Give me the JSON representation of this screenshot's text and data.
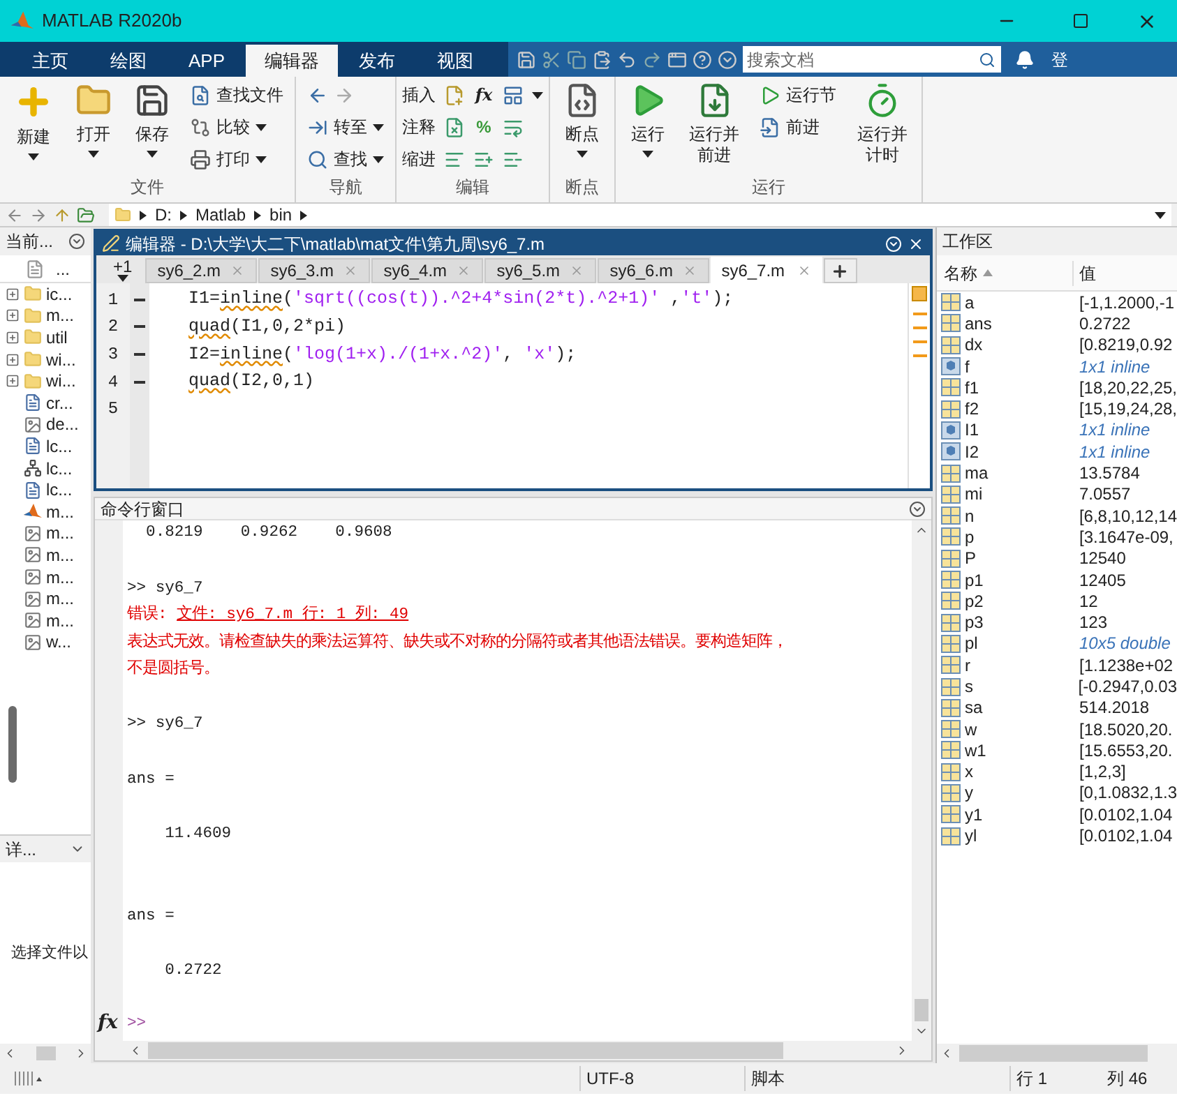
{
  "window": {
    "title": "MATLAB R2020b"
  },
  "ribbon_tabs": [
    {
      "label": "主页",
      "selected": false
    },
    {
      "label": "绘图",
      "selected": false
    },
    {
      "label": "APP",
      "selected": false
    },
    {
      "label": "编辑器",
      "selected": true
    },
    {
      "label": "发布",
      "selected": false
    },
    {
      "label": "视图",
      "selected": false
    }
  ],
  "search": {
    "placeholder": "搜索文档"
  },
  "sign_in": "登",
  "toolstrip": [
    {
      "label": "文件",
      "columns": [
        {
          "kind": "large",
          "items": [
            {
              "label": "新建",
              "dropdown": true
            }
          ]
        },
        {
          "kind": "large",
          "items": [
            {
              "label": "打开",
              "dropdown": true
            }
          ]
        },
        {
          "kind": "large",
          "items": [
            {
              "label": "保存",
              "dropdown": true
            }
          ]
        },
        {
          "kind": "stack",
          "items": [
            {
              "label": "查找文件",
              "dropdown": false
            },
            {
              "label": "比较",
              "dropdown": true
            },
            {
              "label": "打印",
              "dropdown": true
            }
          ]
        }
      ]
    },
    {
      "label": "导航",
      "columns": [
        {
          "kind": "stack",
          "items": [
            {
              "kind": "arrows"
            },
            {
              "label": "转至",
              "dropdown": true
            },
            {
              "label": "查找",
              "dropdown": true
            }
          ]
        }
      ]
    },
    {
      "label": "编辑",
      "columns": [
        {
          "kind": "rows",
          "items": [
            {
              "label": "插入",
              "glyph": "fx",
              "dropdown": true
            },
            {
              "label": "注释",
              "glyph": "%",
              "dropdown": false
            },
            {
              "label": "缩进",
              "dropdown": false
            }
          ]
        }
      ]
    },
    {
      "label": "断点",
      "columns": [
        {
          "kind": "large",
          "items": [
            {
              "label": "断点",
              "dropdown": true
            }
          ]
        }
      ]
    },
    {
      "label": "运行",
      "columns": [
        {
          "kind": "large",
          "items": [
            {
              "label": "运行",
              "dropdown": true
            }
          ]
        },
        {
          "kind": "large",
          "items": [
            {
              "label": "运行并前进",
              "dropdown": false
            }
          ]
        },
        {
          "kind": "stack",
          "items": [
            {
              "label": "运行节",
              "dropdown": false
            },
            {
              "label": "前进",
              "dropdown": false
            }
          ]
        },
        {
          "kind": "large",
          "items": [
            {
              "label": "运行并计时",
              "dropdown": false
            }
          ]
        }
      ]
    }
  ],
  "address_bar": {
    "path": [
      "D:",
      "Matlab",
      "bin"
    ]
  },
  "current_folder": {
    "title": "当前...",
    "column": "...",
    "items": [
      {
        "kind": "folder",
        "name": "ic..."
      },
      {
        "kind": "folder",
        "name": "m..."
      },
      {
        "kind": "folder",
        "name": "util"
      },
      {
        "kind": "folder",
        "name": "wi..."
      },
      {
        "kind": "folder",
        "name": "wi..."
      },
      {
        "kind": "file",
        "name": "cr..."
      },
      {
        "kind": "image",
        "name": "de..."
      },
      {
        "kind": "file",
        "name": "lc..."
      },
      {
        "kind": "network",
        "name": "lc..."
      },
      {
        "kind": "file",
        "name": "lc..."
      },
      {
        "kind": "matlab",
        "name": "m..."
      },
      {
        "kind": "image",
        "name": "m..."
      },
      {
        "kind": "image",
        "name": "m..."
      },
      {
        "kind": "image",
        "name": "m..."
      },
      {
        "kind": "image",
        "name": "m..."
      },
      {
        "kind": "image",
        "name": "m..."
      },
      {
        "kind": "image",
        "name": "w..."
      }
    ],
    "details": "详...",
    "details_text": "选择文件以"
  },
  "editor": {
    "title": "编辑器 - D:\\大学\\大二下\\matlab\\mat文件\\第九周\\sy6_7.m",
    "overflow_tab": "+1",
    "tabs": [
      {
        "label": "sy6_2.m",
        "selected": false
      },
      {
        "label": "sy6_3.m",
        "selected": false
      },
      {
        "label": "sy6_4.m",
        "selected": false
      },
      {
        "label": "sy6_5.m",
        "selected": false
      },
      {
        "label": "sy6_6.m",
        "selected": false
      },
      {
        "label": "sy6_7.m",
        "selected": true
      }
    ],
    "lines": [
      {
        "number": "1",
        "executable": true,
        "segments": [
          {
            "kind": "code",
            "text": "I1="
          },
          {
            "kind": "warn",
            "text": "inline"
          },
          {
            "kind": "code",
            "text": "("
          },
          {
            "kind": "string",
            "text": "'sqrt((cos(t)).^2+4*sin(2*t).^2+1)'"
          },
          {
            "kind": "code",
            "text": " ,"
          },
          {
            "kind": "string",
            "text": "'t'"
          },
          {
            "kind": "code",
            "text": ");"
          }
        ]
      },
      {
        "number": "2",
        "executable": true,
        "segments": [
          {
            "kind": "warn",
            "text": "quad"
          },
          {
            "kind": "code",
            "text": "(I1,0,2*pi)"
          }
        ]
      },
      {
        "number": "3",
        "executable": true,
        "segments": [
          {
            "kind": "code",
            "text": "I2="
          },
          {
            "kind": "warn",
            "text": "inline"
          },
          {
            "kind": "code",
            "text": "("
          },
          {
            "kind": "string",
            "text": "'log(1+x)./(1+x.^2)'"
          },
          {
            "kind": "code",
            "text": ", "
          },
          {
            "kind": "string",
            "text": "'x'"
          },
          {
            "kind": "code",
            "text": ");"
          }
        ]
      },
      {
        "number": "4",
        "executable": true,
        "segments": [
          {
            "kind": "warn",
            "text": "quad"
          },
          {
            "kind": "code",
            "text": "(I2,0,1)"
          }
        ]
      },
      {
        "number": "5",
        "executable": false
      }
    ]
  },
  "command_window": {
    "title": "命令行窗口",
    "fx": "fx",
    "prompt": ">>",
    "lines": [
      {
        "kind": "output",
        "text": "  0.8219    0.9262    0.9608"
      },
      {
        "kind": "blank"
      },
      {
        "kind": "input",
        "text": ">> sy6_7"
      },
      {
        "kind": "error",
        "text": "错误: ",
        "link": "文件: sy6_7.m 行: 1 列: 49"
      },
      {
        "kind": "error",
        "text": "表达式无效。请检查缺失的乘法运算符、缺失或不对称的分隔符或者其他语法错误。要构造矩阵，"
      },
      {
        "kind": "error",
        "text": "不是圆括号。"
      },
      {
        "kind": "blank"
      },
      {
        "kind": "input",
        "text": ">> sy6_7"
      },
      {
        "kind": "blank"
      },
      {
        "kind": "output",
        "text": "ans ="
      },
      {
        "kind": "blank"
      },
      {
        "kind": "output",
        "text": "    11.4609"
      },
      {
        "kind": "blank"
      },
      {
        "kind": "blank"
      },
      {
        "kind": "output",
        "text": "ans ="
      },
      {
        "kind": "blank"
      },
      {
        "kind": "output",
        "text": "    0.2722"
      }
    ]
  },
  "workspace": {
    "title": "工作区",
    "columns": [
      "名称",
      "值"
    ],
    "rows": [
      {
        "kind": "matrix",
        "name": "a",
        "value": "[-1,1.2000,-1",
        "italic": false
      },
      {
        "kind": "matrix",
        "name": "ans",
        "value": "0.2722",
        "italic": false
      },
      {
        "kind": "matrix",
        "name": "dx",
        "value": "[0.8219,0.92",
        "italic": false
      },
      {
        "kind": "object",
        "name": "f",
        "value": "1x1 inline",
        "italic": true
      },
      {
        "kind": "matrix",
        "name": "f1",
        "value": "[18,20,22,25,",
        "italic": false
      },
      {
        "kind": "matrix",
        "name": "f2",
        "value": "[15,19,24,28,",
        "italic": false
      },
      {
        "kind": "object",
        "name": "I1",
        "value": "1x1 inline",
        "italic": true
      },
      {
        "kind": "object",
        "name": "I2",
        "value": "1x1 inline",
        "italic": true
      },
      {
        "kind": "matrix",
        "name": "ma",
        "value": "13.5784",
        "italic": false
      },
      {
        "kind": "matrix",
        "name": "mi",
        "value": "7.0557",
        "italic": false
      },
      {
        "kind": "matrix",
        "name": "n",
        "value": "[6,8,10,12,14",
        "italic": false
      },
      {
        "kind": "matrix",
        "name": "p",
        "value": "[3.1647e-09,",
        "italic": false
      },
      {
        "kind": "matrix",
        "name": "P",
        "value": "12540",
        "italic": false
      },
      {
        "kind": "matrix",
        "name": "p1",
        "value": "12405",
        "italic": false
      },
      {
        "kind": "matrix",
        "name": "p2",
        "value": "12",
        "italic": false
      },
      {
        "kind": "matrix",
        "name": "p3",
        "value": "123",
        "italic": false
      },
      {
        "kind": "matrix",
        "name": "pl",
        "value": "10x5 double",
        "italic": true
      },
      {
        "kind": "matrix",
        "name": "r",
        "value": "[1.1238e+02",
        "italic": false
      },
      {
        "kind": "matrix",
        "name": "s",
        "value": "[-0.2947,0.03",
        "italic": false
      },
      {
        "kind": "matrix",
        "name": "sa",
        "value": "514.2018",
        "italic": false
      },
      {
        "kind": "matrix",
        "name": "w",
        "value": "[18.5020,20.",
        "italic": false
      },
      {
        "kind": "matrix",
        "name": "w1",
        "value": "[15.6553,20.",
        "italic": false
      },
      {
        "kind": "matrix",
        "name": "x",
        "value": "[1,2,3]",
        "italic": false
      },
      {
        "kind": "matrix",
        "name": "y",
        "value": "[0,1.0832,1.3",
        "italic": false
      },
      {
        "kind": "matrix",
        "name": "y1",
        "value": "[0.0102,1.04",
        "italic": false
      },
      {
        "kind": "matrix",
        "name": "yl",
        "value": "[0.0102,1.04",
        "italic": false
      }
    ]
  },
  "status_bar": {
    "encoding": "UTF-8",
    "file_type": "脚本",
    "line": "行 1",
    "column": "列 46"
  }
}
